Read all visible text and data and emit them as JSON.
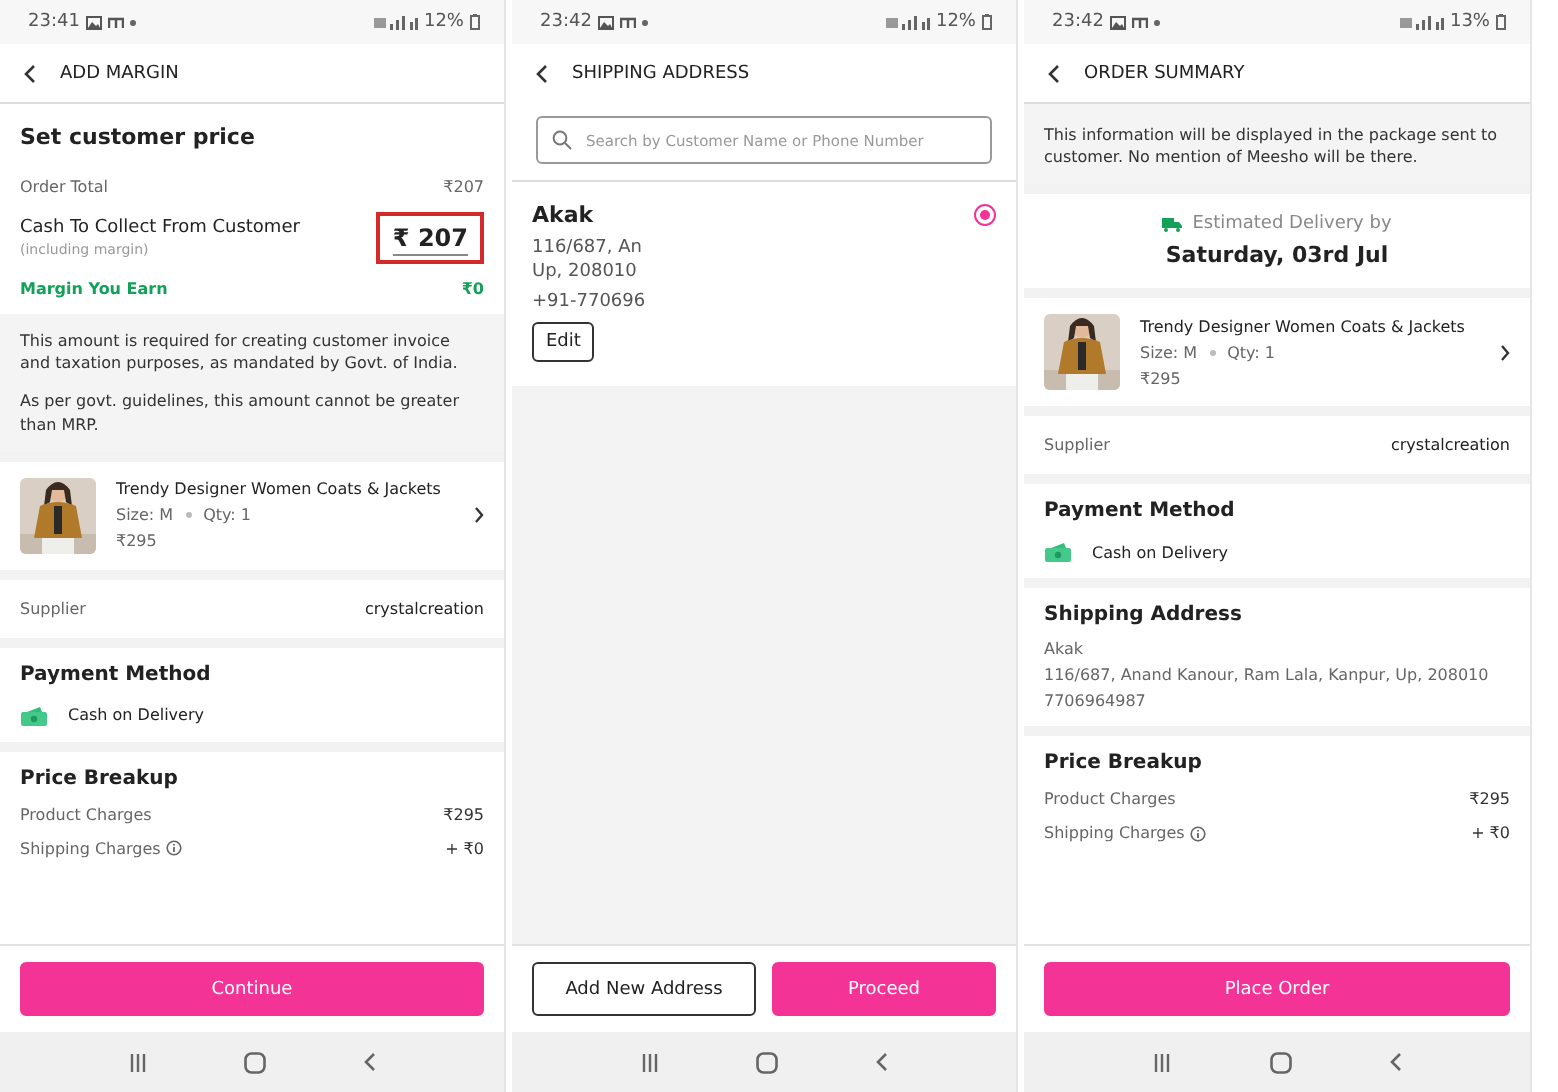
{
  "add_margin": {
    "status_bar": {
      "time": "23:41",
      "battery": "12%"
    },
    "title": "ADD MARGIN",
    "heading": "Set customer price",
    "order_total": {
      "label": "Order Total",
      "value": "₹207"
    },
    "cash_to_collect": {
      "label": "Cash To Collect From Customer",
      "note": "(including margin)",
      "value": "₹ 207",
      "highlighted": true
    },
    "margin": {
      "label": "Margin You Earn",
      "value": "₹0"
    },
    "notes": [
      "This amount is required for creating customer invoice and taxation purposes, as mandated by Govt. of India.",
      "As per govt. guidelines, this amount cannot be greater than MRP."
    ],
    "product": {
      "name": "Trendy Designer Women Coats & Jackets",
      "size": "Size: M",
      "qty": "Qty: 1",
      "price": "₹295"
    },
    "supplier": {
      "label": "Supplier",
      "value": "crystalcreation"
    },
    "payment": {
      "heading": "Payment Method",
      "method": "Cash on Delivery"
    },
    "price_breakup": {
      "heading": "Price Breakup",
      "rows": [
        {
          "label": "Product Charges",
          "value": "₹295",
          "info": false
        },
        {
          "label": "Shipping Charges",
          "value": "+ ₹0",
          "info": true
        }
      ]
    },
    "button": "Continue"
  },
  "shipping_address": {
    "status_bar": {
      "time": "23:42",
      "battery": "12%"
    },
    "title": "SHIPPING ADDRESS",
    "search": {
      "placeholder": "Search by Customer Name or Phone Number"
    },
    "addresses": [
      {
        "name": "Akak",
        "lines": [
          "116/687, An",
          "Up, 208010"
        ],
        "phone": "+91-770696",
        "selected": true,
        "edit": "Edit"
      }
    ],
    "buttons": [
      {
        "label": "Add New Address",
        "kind": "outline"
      },
      {
        "label": "Proceed",
        "kind": "primary"
      }
    ]
  },
  "order_summary": {
    "status_bar": {
      "time": "23:42",
      "battery": "13%"
    },
    "title": "ORDER SUMMARY",
    "info_note": "This information will be displayed in the package sent to customer. No mention of Meesho will be there.",
    "delivery": {
      "label": "Estimated Delivery by",
      "date": "Saturday, 03rd Jul"
    },
    "product": {
      "name": "Trendy Designer Women Coats & Jackets",
      "size": "Size: M",
      "qty": "Qty: 1",
      "price": "₹295"
    },
    "supplier": {
      "label": "Supplier",
      "value": "crystalcreation"
    },
    "payment": {
      "heading": "Payment Method",
      "method": "Cash on Delivery"
    },
    "shipping_address": {
      "heading": "Shipping Address",
      "name": "Akak",
      "address": "116/687, Anand Kanour, Ram Lala, Kanpur, Up, 208010",
      "phone": "7706964987"
    },
    "price_breakup": {
      "heading": "Price Breakup",
      "rows": [
        {
          "label": "Product Charges",
          "value": "₹295",
          "info": false
        },
        {
          "label": "Shipping Charges",
          "value": "+ ₹0",
          "info": true
        }
      ]
    },
    "button": "Place Order"
  }
}
